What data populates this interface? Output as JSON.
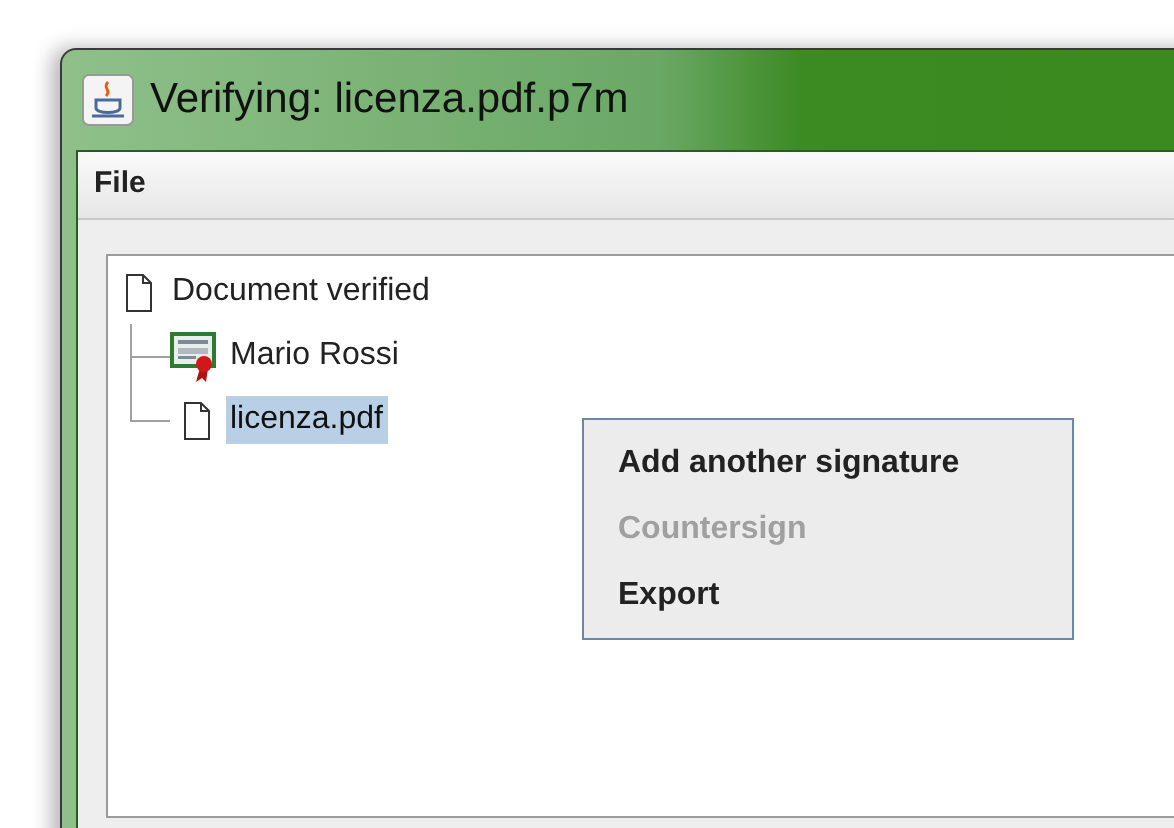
{
  "window": {
    "title": "Verifying: licenza.pdf.p7m"
  },
  "menu_bar": [
    "File"
  ],
  "tree": [
    {
      "label": "Document verified",
      "kind": "document",
      "selected": false,
      "children": [
        {
          "label": "Mario Rossi",
          "kind": "certificate",
          "selected": false
        },
        {
          "label": "licenza.pdf",
          "kind": "document",
          "selected": true
        }
      ]
    }
  ],
  "context_menu": [
    {
      "label": "Add another signature",
      "disabled": false
    },
    {
      "label": "Countersign",
      "disabled": true
    },
    {
      "label": "Export",
      "disabled": false
    }
  ]
}
